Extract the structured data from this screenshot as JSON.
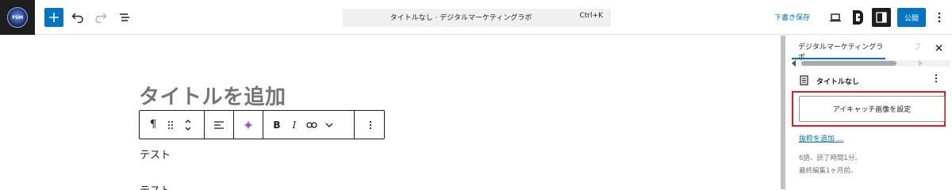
{
  "site_logo": {
    "text": "FSM"
  },
  "header": {
    "command_title": "タイトルなし · デジタルマーケティングラボ",
    "command_shortcut": "Ctrl+K",
    "save_draft": "下書き保存",
    "publish": "公開",
    "accent_color": "#0075c4"
  },
  "editor": {
    "title_placeholder": "タイトルを追加",
    "paragraphs": [
      "テスト",
      "テスト"
    ]
  },
  "sidebar": {
    "active_tab": "デジタルマーケティングラボ",
    "hidden_tab": "ブ",
    "document_title": "タイトルなし",
    "featured_image_button": "アイキャッチ画像を設定",
    "excerpt_link": "抜粋を追加 ...",
    "word_count": "6語、読了時間1分。",
    "last_edited": "最終編集1ヶ月前。",
    "highlight_color": "#e01b24"
  },
  "icons": {
    "add": "plus-icon",
    "undo": "undo-icon",
    "redo": "redo-icon",
    "list_view": "list-view-icon",
    "preview": "laptop-icon",
    "settings": "sidebar-toggle-icon",
    "options": "more-vertical-icon"
  }
}
